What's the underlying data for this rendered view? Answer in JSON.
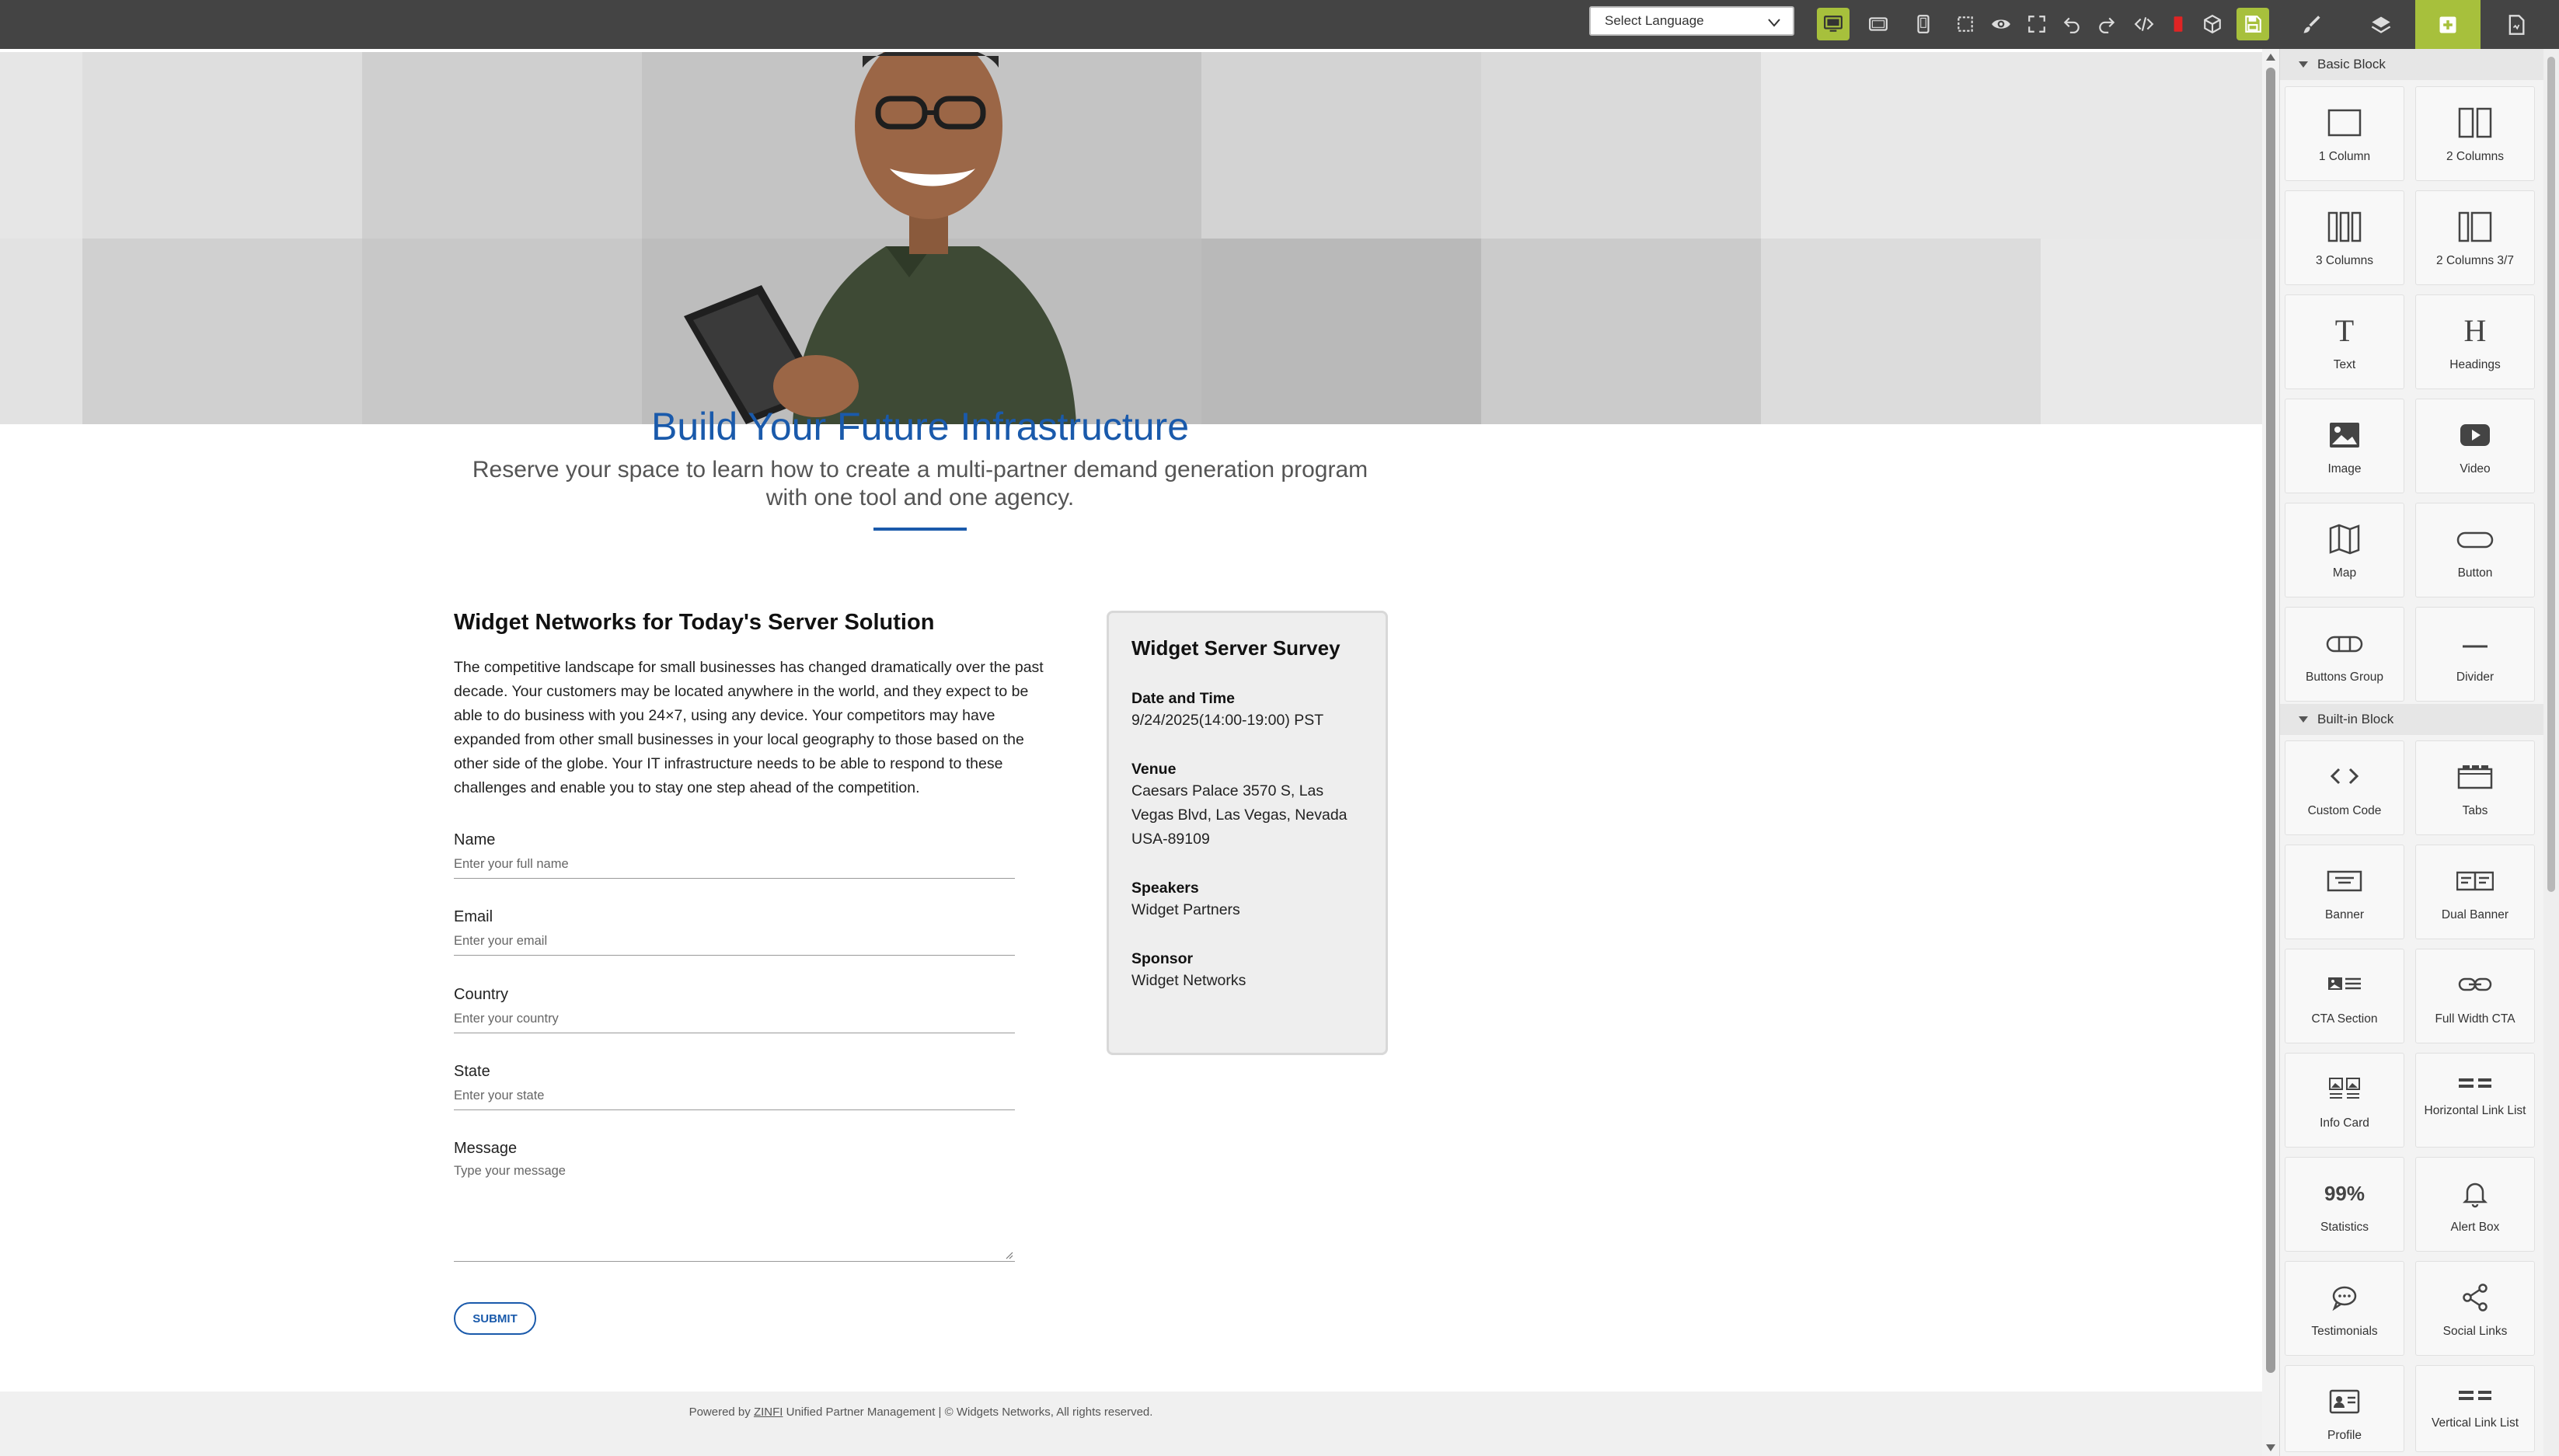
{
  "toolbar": {
    "language_select": "Select Language"
  },
  "page": {
    "title": "Build Your Future Infrastructure",
    "subtitle_line1": "Reserve your space to learn how to create a multi-partner demand generation program",
    "subtitle_line2": "with one tool and one agency.",
    "section_title": "Widget Networks for Today's Server Solution",
    "section_body": "The competitive landscape for small businesses has changed dramatically over the past decade. Your customers may be located anywhere in the world, and they expect to be able to do business with you 24×7, using any device. Your competitors may have expanded from other small businesses in your local geography to those based on the other side of the globe. Your IT infrastructure needs to be able to respond to these challenges and enable you to stay one step ahead of the competition."
  },
  "form": {
    "name_label": "Name",
    "name_placeholder": "Enter your full name",
    "email_label": "Email",
    "email_placeholder": "Enter your email",
    "country_label": "Country",
    "country_placeholder": "Enter your country",
    "state_label": "State",
    "state_placeholder": "Enter your state",
    "message_label": "Message",
    "message_placeholder": "Type your message",
    "submit_label": "SUBMIT"
  },
  "card": {
    "title": "Widget Server Survey",
    "date_label": "Date and Time",
    "date_value": "9/24/2025(14:00-19:00) PST",
    "venue_label": "Venue",
    "venue_line1": "Caesars Palace 3570 S, Las",
    "venue_line2": "Vegas Blvd, Las Vegas, Nevada",
    "venue_line3": "USA-89109",
    "speakers_label": "Speakers",
    "speakers_value": "Widget Partners",
    "sponsor_label": "Sponsor",
    "sponsor_value": "Widget Networks"
  },
  "footer": {
    "prefix": "Powered by ",
    "link": "ZINFI",
    "suffix": " Unified Partner Management | © Widgets Networks, All rights reserved."
  },
  "panel": {
    "basic_heading": "Basic Block",
    "builtin_heading": "Built-in Block",
    "basic_blocks": [
      "1 Column",
      "2 Columns",
      "3 Columns",
      "2 Columns 3/7",
      "Text",
      "Headings",
      "Image",
      "Video",
      "Map",
      "Button",
      "Buttons Group",
      "Divider"
    ],
    "builtin_blocks": [
      "Custom Code",
      "Tabs",
      "Banner",
      "Dual Banner",
      "CTA Section",
      "Full Width CTA",
      "Info Card",
      "Horizontal Link List",
      "Statistics",
      "Alert Box",
      "Testimonials",
      "Social Links",
      "Profile",
      "Vertical Link List"
    ],
    "text_icon": "T",
    "headings_icon": "H",
    "statistics_icon": "99%"
  },
  "colors": {
    "accent": "#a7c03c",
    "brand_blue": "#1a5aab",
    "toolbar_bg": "#444444",
    "recording": "#e02424"
  }
}
